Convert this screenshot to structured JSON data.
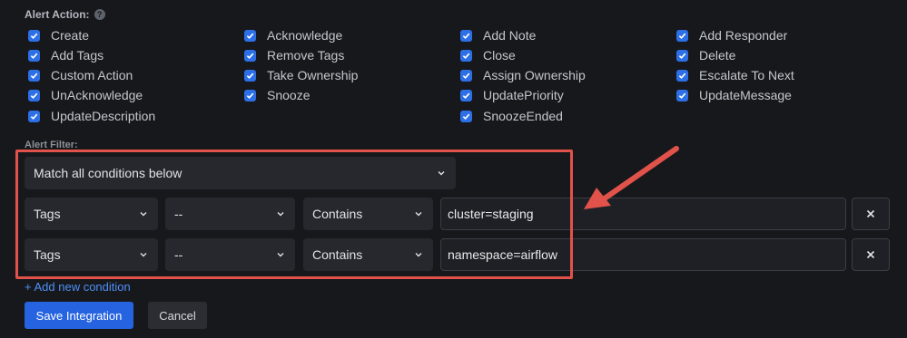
{
  "alert_action": {
    "label": "Alert Action:",
    "help_icon": "question-circle-icon",
    "options": [
      [
        "Create",
        "Add Tags",
        "Custom Action",
        "UnAcknowledge",
        "UpdateDescription"
      ],
      [
        "Acknowledge",
        "Remove Tags",
        "Take Ownership",
        "Snooze"
      ],
      [
        "Add Note",
        "Close",
        "Assign Ownership",
        "UpdatePriority",
        "SnoozeEnded"
      ],
      [
        "Add Responder",
        "Delete",
        "Escalate To Next",
        "UpdateMessage"
      ]
    ]
  },
  "alert_filter": {
    "label": "Alert Filter:",
    "match_mode": "Match all conditions below",
    "conditions": [
      {
        "field": "Tags",
        "key": "--",
        "operator": "Contains",
        "value": "cluster=staging"
      },
      {
        "field": "Tags",
        "key": "--",
        "operator": "Contains",
        "value": "namespace=airflow"
      }
    ],
    "add_condition": "+ Add new condition"
  },
  "buttons": {
    "save": "Save Integration",
    "cancel": "Cancel"
  },
  "colors": {
    "checkbox": "#2d6fe6",
    "highlight": "#e0524a",
    "link": "#4f8ff7",
    "primary_button": "#2563e0"
  }
}
